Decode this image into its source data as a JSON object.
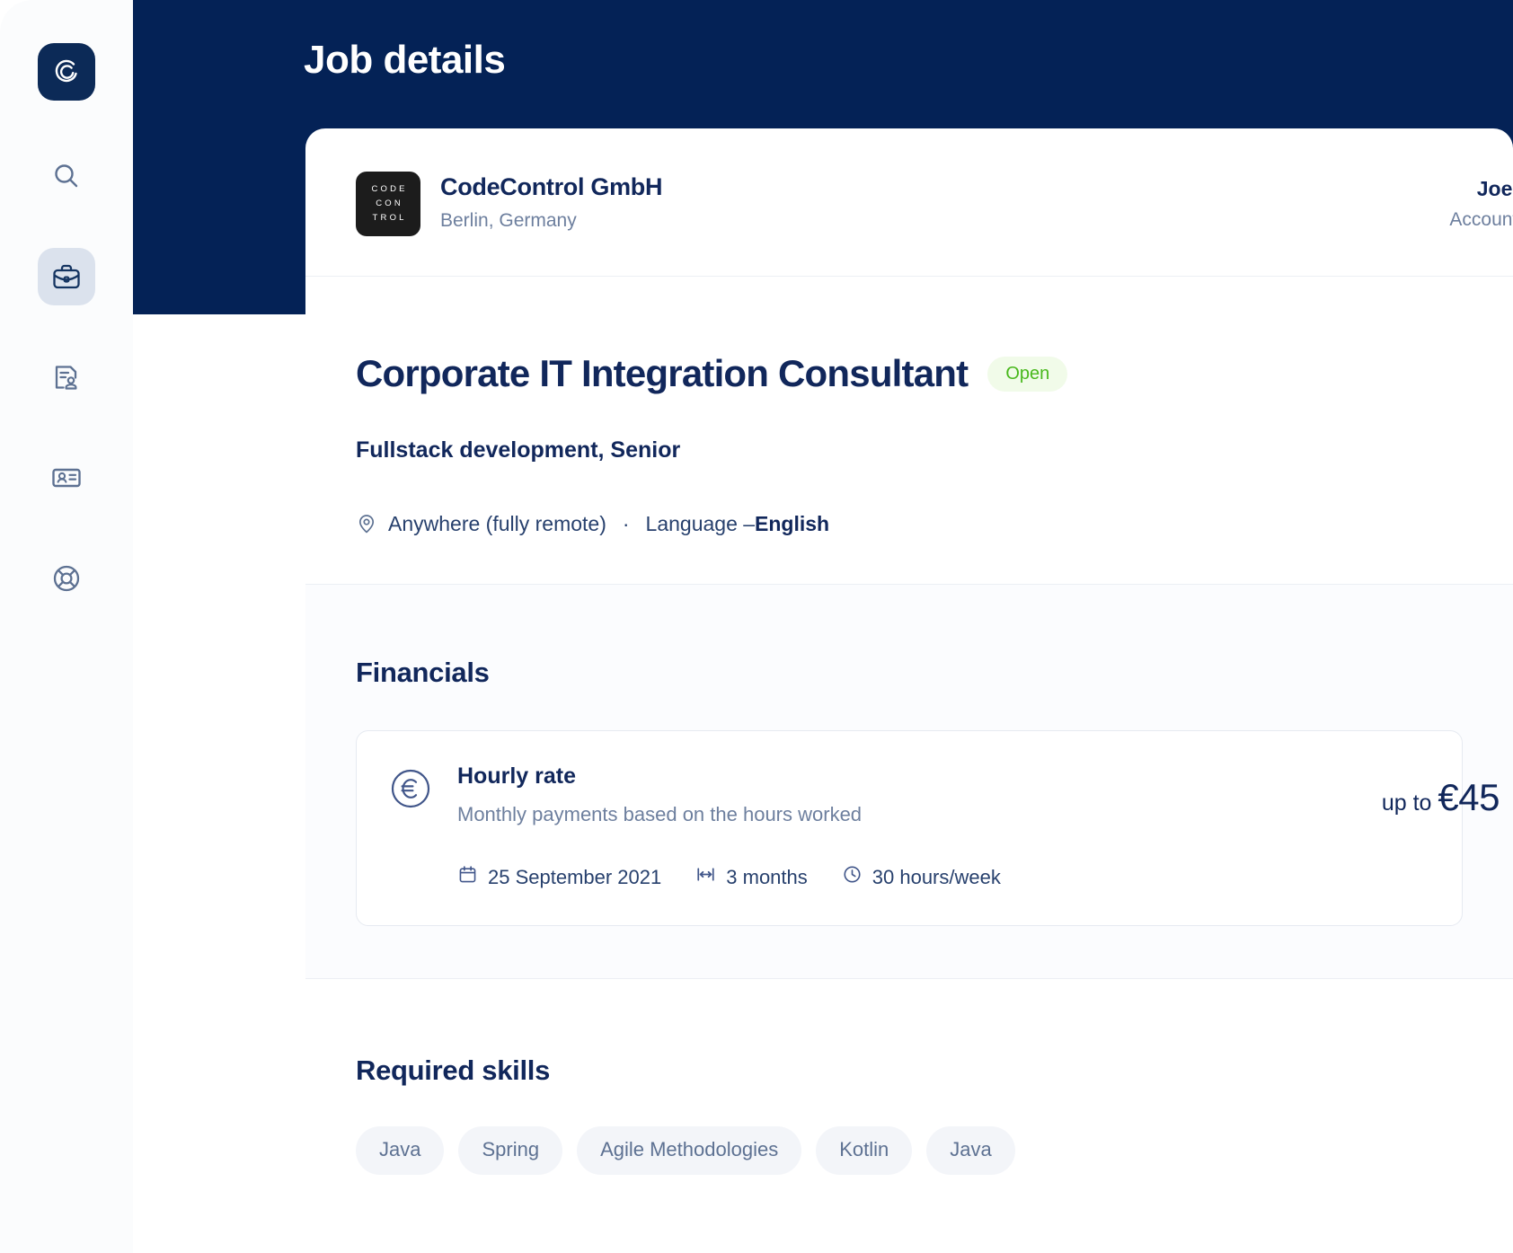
{
  "header": {
    "title": "Job details"
  },
  "sidebar": {
    "logo_name": "app-logo",
    "items": [
      {
        "id": "search",
        "icon": "search-icon",
        "active": false
      },
      {
        "id": "jobs",
        "icon": "briefcase-icon",
        "active": true
      },
      {
        "id": "contracts",
        "icon": "document-user-icon",
        "active": false
      },
      {
        "id": "profile",
        "icon": "id-card-icon",
        "active": false
      },
      {
        "id": "support",
        "icon": "lifebuoy-icon",
        "active": false
      }
    ]
  },
  "company": {
    "logo_lines": [
      "CODE",
      "CON",
      "TROL"
    ],
    "name": "CodeControl GmbH",
    "location": "Berlin, Germany"
  },
  "account_manager": {
    "name": "Joe LeFevre",
    "role": "Account manager"
  },
  "job": {
    "title": "Corporate IT Integration Consultant",
    "status": "Open",
    "subtitle": "Fullstack development, Senior",
    "location": "Anywhere (fully remote)",
    "separator": "·",
    "language_label": "Language – ",
    "language_value": "English"
  },
  "financials": {
    "section_title": "Financials",
    "rate": {
      "name": "Hourly rate",
      "description": "Monthly payments based on the hours worked",
      "amount_prefix": "up to ",
      "amount": "€45",
      "start_date": "25 September 2021",
      "duration": "3 months",
      "hours": "30 hours/week"
    }
  },
  "skills": {
    "section_title": "Required skills",
    "items": [
      "Java",
      "Spring",
      "Agile Methodologies",
      "Kotlin",
      "Java"
    ]
  },
  "colors": {
    "navy": "#042256",
    "text_navy": "#11275b",
    "muted": "#6d7f9e",
    "status_green": "#49b81c",
    "status_green_bg": "#f1fbe9",
    "pill_bg": "#f3f5f9",
    "rail_bg": "#fbfcfd",
    "rail_active": "#dbe2ed"
  }
}
